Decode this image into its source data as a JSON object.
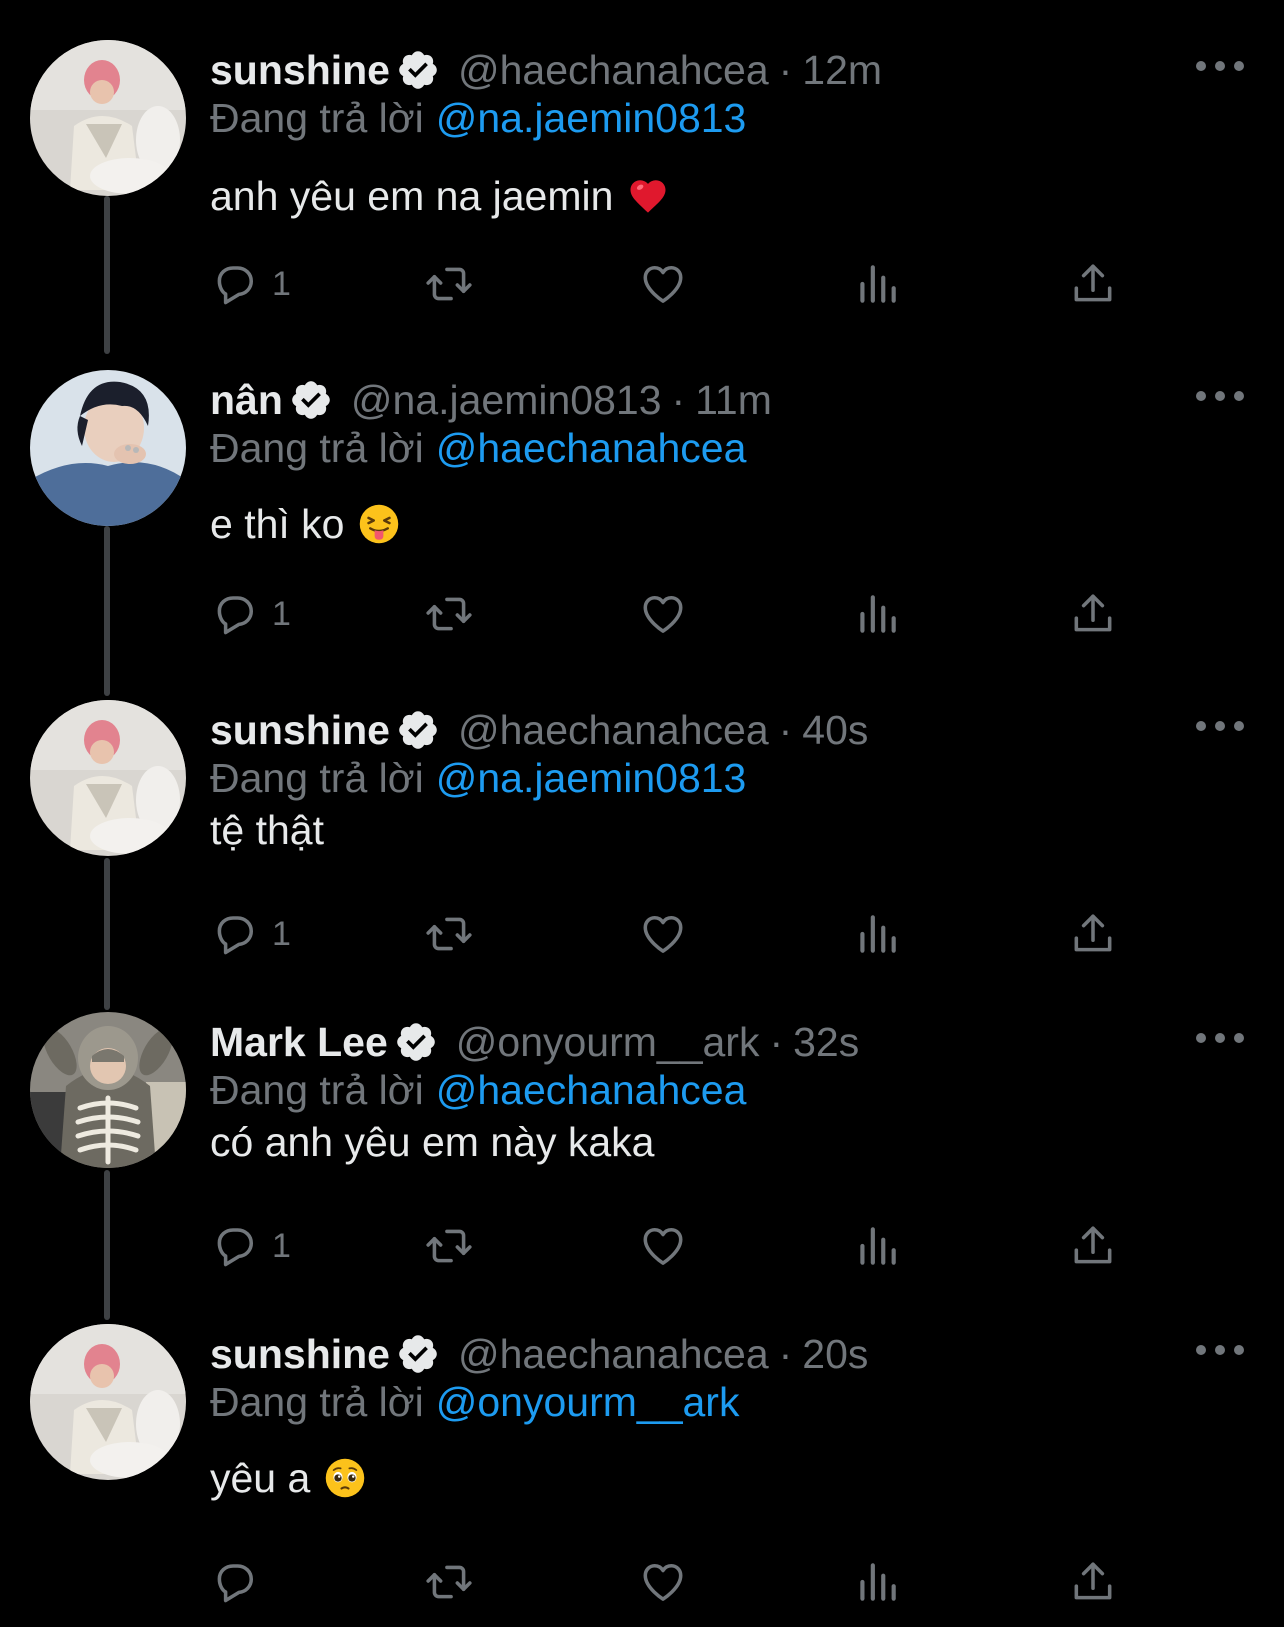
{
  "colors": {
    "background": "#000000",
    "primary_text": "#e7e9ea",
    "secondary_text": "#71767b",
    "link_blue": "#1d9bf0",
    "thread_line": "#3e4144"
  },
  "tweets": [
    {
      "display_name": "sunshine",
      "handle": "@haechanahcea",
      "separator": "·",
      "time": "12m",
      "reply_prefix": "Đang trả lời",
      "reply_to": "@na.jaemin0813",
      "text": "anh yêu em na jaemin",
      "emoji": "red-heart-emoji",
      "reply_count": "1",
      "avatar": "pink-hair-avatar"
    },
    {
      "display_name": "nân",
      "handle": "@na.jaemin0813",
      "separator": "·",
      "time": "11m",
      "reply_prefix": "Đang trả lời",
      "reply_to": "@haechanahcea",
      "text": "e thì ko",
      "emoji": "squinting-tongue-emoji",
      "reply_count": "1",
      "avatar": "dark-hair-blue-avatar"
    },
    {
      "display_name": "sunshine",
      "handle": "@haechanahcea",
      "separator": "·",
      "time": "40s",
      "reply_prefix": "Đang trả lời",
      "reply_to": "@na.jaemin0813",
      "text": "tệ thật",
      "emoji": "",
      "reply_count": "1",
      "avatar": "pink-hair-avatar"
    },
    {
      "display_name": "Mark Lee",
      "handle": "@onyourm__ark",
      "separator": "·",
      "time": "32s",
      "reply_prefix": "Đang trả lời",
      "reply_to": "@haechanahcea",
      "text": "có anh yêu em này kaka",
      "emoji": "",
      "reply_count": "1",
      "avatar": "hoodie-avatar"
    },
    {
      "display_name": "sunshine",
      "handle": "@haechanahcea",
      "separator": "·",
      "time": "20s",
      "reply_prefix": "Đang trả lời",
      "reply_to": "@onyourm__ark",
      "text": "yêu a",
      "emoji": "pleading-face-emoji",
      "reply_count": "",
      "avatar": "pink-hair-avatar"
    }
  ]
}
